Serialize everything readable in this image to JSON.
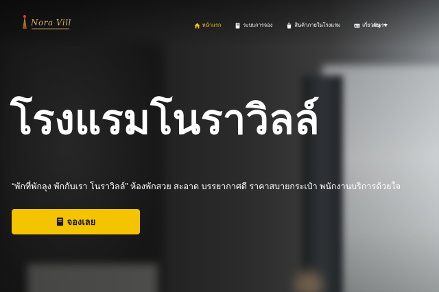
{
  "header": {
    "logo_text": "Nora Vill",
    "nav": [
      {
        "label": "หน้าแรก",
        "icon": "home-icon",
        "active": true
      },
      {
        "label": "ระบบการจอง",
        "icon": "book-icon",
        "active": false
      },
      {
        "label": "สินค้าภายในโรงแรม",
        "icon": "shopping-bag-icon",
        "active": false
      },
      {
        "label": "เกี่ยวกับเรา",
        "icon": "id-card-icon",
        "active": false
      }
    ],
    "menu_label": "เมนู"
  },
  "hero": {
    "title": "โรงแรมโนราวิลล์",
    "tagline": "“พักที่พักลุง พักกับเรา โนราวิลล์”  ห้องพักสวย สะอาด บรรยากาศดี ราคาสบายกระเป๋า พนักงานบริการด้วยใจ",
    "book_button": "จองเลย"
  },
  "colors": {
    "accent": "#f5c400",
    "text": "#ffffff",
    "logo": "#d9b061"
  }
}
